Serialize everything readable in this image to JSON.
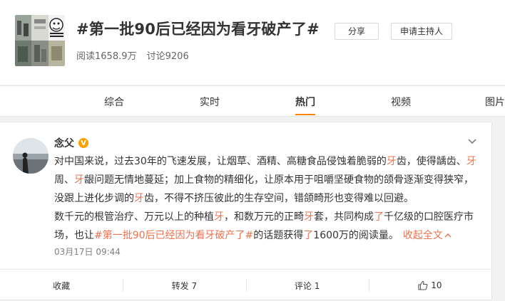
{
  "topic": {
    "title": "#第一批90后已经因为看牙破产了#",
    "reads": "阅读1658.9万",
    "discussions": "讨论9206",
    "share_label": "分享",
    "apply_host_label": "申请主持人"
  },
  "tabs": [
    {
      "label": "综合"
    },
    {
      "label": "实时"
    },
    {
      "label": "热门"
    },
    {
      "label": "视频"
    },
    {
      "label": "图片"
    }
  ],
  "active_tab": "热门",
  "accent_color": "#ff8200",
  "highlight_color": "#eb7350",
  "post": {
    "author": "念父",
    "verified_badge": "V",
    "time": "03月17日 09:44",
    "para1": {
      "t1": "对中国来说，过去30年的飞速发展，让烟草、酒精、高糖食品侵蚀着脆弱的",
      "h1": "牙",
      "t2": "齿，使得龋齿、",
      "h2": "牙",
      "t3": "周、",
      "h3": "牙",
      "t4": "龈问题无情地蔓延；加上食物的精细化，让原本用于咀嚼坚硬食物的颌骨逐渐变得狭窄，没跟上进化步调的",
      "h4": "牙",
      "t5": "齿，不得不挤压彼此的生存空间，错颌畸形也变得难以回避。"
    },
    "para2": {
      "t1": "数千元的根管治疗、万元以上的种植",
      "h1": "牙",
      "t2": "，和数万元的正畸",
      "h2": "牙",
      "t3": "套，共同构成",
      "h3": "了",
      "t4": "千亿级的口腔医疗市场，也让",
      "link": "#第一批90后已经因为看牙破产了#",
      "t5": "的话题获得",
      "h4": "了",
      "t6": "1600万的阅读量。",
      "collapse": "收起全文"
    },
    "actions": {
      "favorite": "收藏",
      "repost": "转发 7",
      "comment": "评论 1",
      "like_count": "10"
    }
  }
}
